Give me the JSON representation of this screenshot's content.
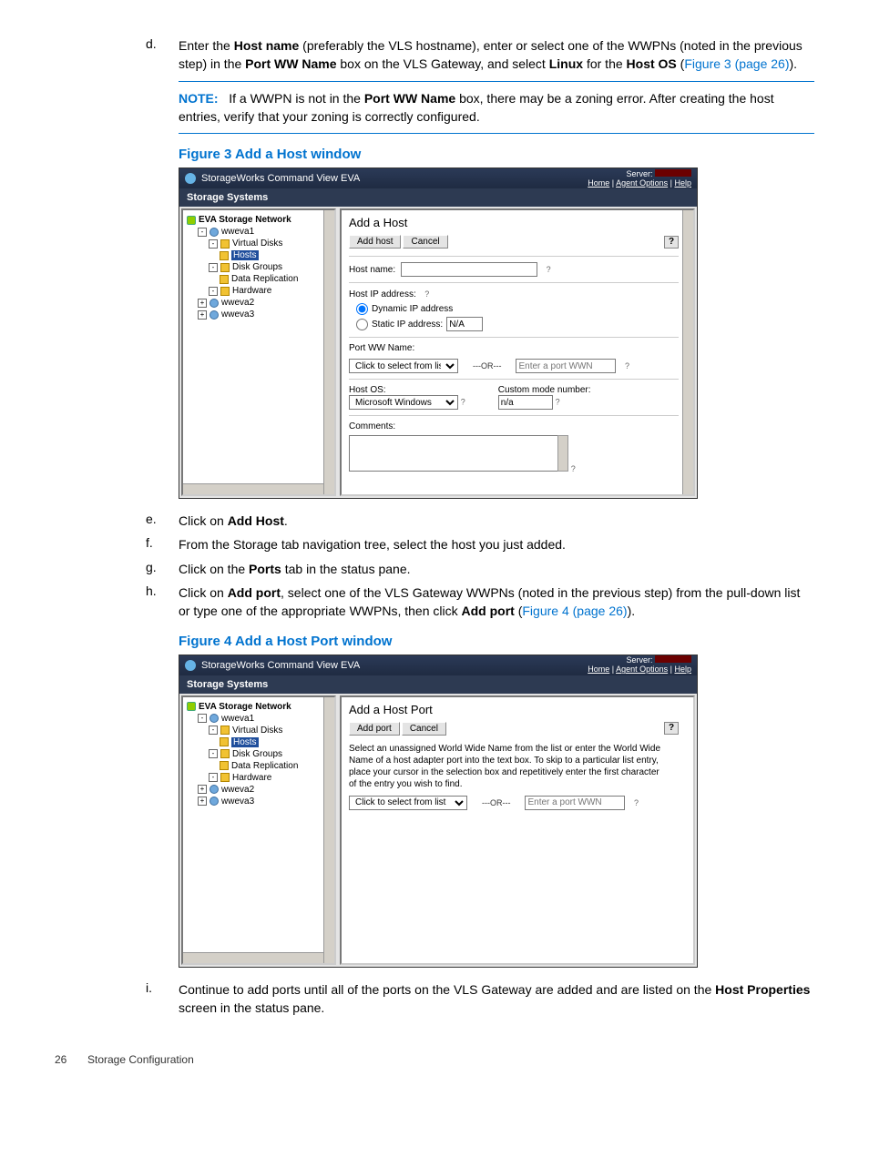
{
  "steps": {
    "d": {
      "marker": "d.",
      "t1": "Enter the ",
      "b1": "Host name",
      "t2": " (preferably the VLS hostname), enter or select one of the WWPNs (noted in the previous step) in the ",
      "b2": "Port WW Name",
      "t3": " box on the VLS Gateway, and select ",
      "b3": "Linux",
      "t4": " for the ",
      "b4": "Host OS",
      "t5": " (",
      "xref": "Figure 3 (page 26)",
      "t6": ")."
    },
    "e": {
      "marker": "e.",
      "t1": "Click on ",
      "b1": "Add Host",
      "t2": "."
    },
    "f": {
      "marker": "f.",
      "t1": "From the Storage tab navigation tree, select the host you just added."
    },
    "g": {
      "marker": "g.",
      "t1": "Click on the ",
      "b1": "Ports",
      "t2": " tab in the status pane."
    },
    "h": {
      "marker": "h.",
      "t1": "Click on ",
      "b1": "Add port",
      "t2": ", select one of the VLS Gateway WWPNs (noted in the previous step) from the pull-down list or type one of the appropriate WWPNs, then click ",
      "b2": "Add port",
      "t3": " (",
      "xref": "Figure 4 (page 26)",
      "t4": ")."
    },
    "i": {
      "marker": "i.",
      "t1": "Continue to add ports until all of the ports on the VLS Gateway are added and are listed on the ",
      "b1": "Host Properties",
      "t2": " screen in the status pane."
    }
  },
  "note": {
    "label": "NOTE:",
    "t1": "If a WWPN is not in the ",
    "b1": "Port WW Name",
    "t2": " box, there may be a zoning error. After creating the host entries, verify that your zoning is correctly configured."
  },
  "figures": {
    "f3": {
      "caption": "Figure 3 Add a Host window"
    },
    "f4": {
      "caption": "Figure 4 Add a Host Port window"
    }
  },
  "app": {
    "title": "StorageWorks Command View EVA",
    "server_label": "Server:",
    "links": {
      "home": "Home",
      "agent": "Agent Options",
      "help": "Help"
    },
    "subbar": "Storage Systems",
    "tree": {
      "root": "EVA Storage Network",
      "n1": "wweva1",
      "n1a": "Virtual Disks",
      "n1b": "Hosts",
      "n1c": "Disk Groups",
      "n1d": "Data Replication",
      "n1e": "Hardware",
      "n2": "wweva2",
      "n3": "wweva3"
    },
    "fig3": {
      "title": "Add a Host",
      "btn_add": "Add host",
      "btn_cancel": "Cancel",
      "hostname_label": "Host name:",
      "hostip_label": "Host IP address:",
      "dyn_ip": "Dynamic IP address",
      "static_ip": "Static IP address:",
      "static_ip_val": "N/A",
      "portww_label": "Port WW Name:",
      "select_list": "Click to select from list",
      "or": "---OR---",
      "enter_wwn_ph": "Enter a port WWN",
      "hostos_label": "Host OS:",
      "hostos_val": "Microsoft Windows",
      "custom_label": "Custom mode number:",
      "custom_val": "n/a",
      "comments_label": "Comments:"
    },
    "fig4": {
      "title": "Add a Host Port",
      "btn_add": "Add port",
      "btn_cancel": "Cancel",
      "instructions": "Select an unassigned World Wide Name from the list or enter the World Wide Name of a host adapter port into the text box. To skip to a particular list entry, place your cursor in the selection box and repetitively enter the first character of the entry you wish to find.",
      "select_list": "Click to select from list",
      "or": "---OR---",
      "enter_wwn_ph": "Enter a port WWN"
    }
  },
  "footer": {
    "page": "26",
    "title": "Storage Configuration"
  }
}
